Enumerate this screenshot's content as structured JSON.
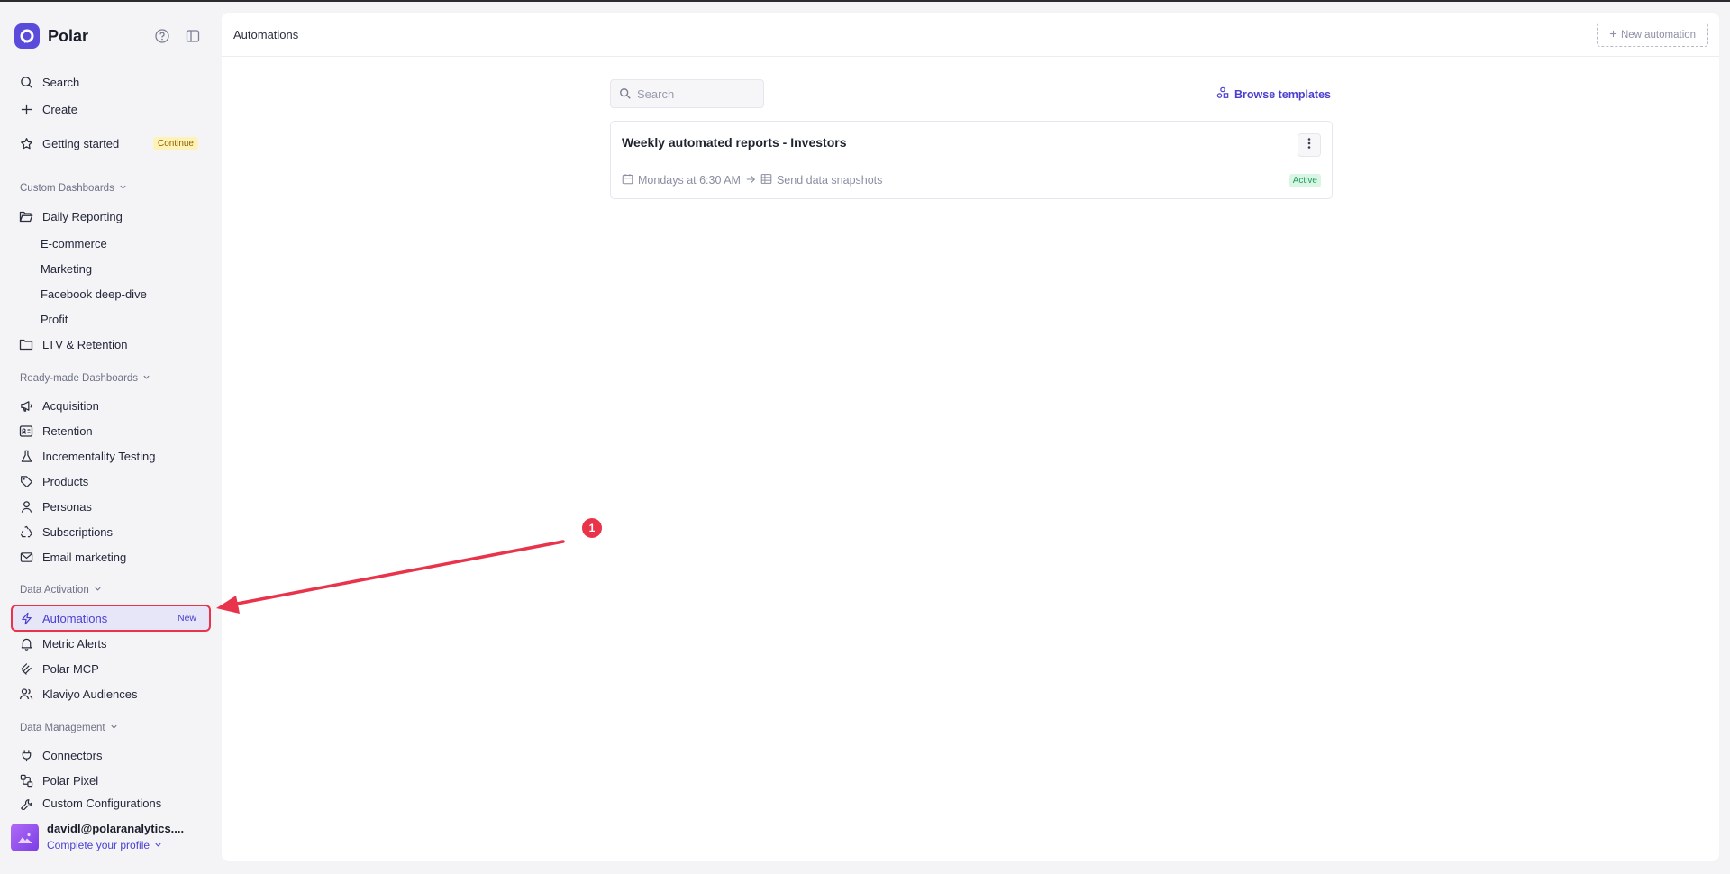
{
  "app": {
    "brand": "Polar",
    "colors": {
      "accent": "#4a3fd1",
      "brand": "#5b4bdb",
      "highlight": "#e8334a",
      "active_badge": "#1f9a5a"
    }
  },
  "sidebar": {
    "top_items": [
      {
        "label": "Search",
        "icon": "search-icon"
      },
      {
        "label": "Create",
        "icon": "plus-icon"
      },
      {
        "label": "Getting started",
        "icon": "star-icon",
        "badge": "Continue"
      }
    ],
    "custom_dashboards": {
      "label": "Custom Dashboards",
      "folder": "Daily Reporting",
      "children": [
        "E-commerce",
        "Marketing",
        "Facebook deep-dive",
        "Profit"
      ],
      "folder2": "LTV & Retention"
    },
    "ready_made": {
      "label": "Ready-made Dashboards",
      "items": [
        {
          "label": "Acquisition",
          "icon": "megaphone-icon"
        },
        {
          "label": "Retention",
          "icon": "id-card-icon"
        },
        {
          "label": "Incrementality Testing",
          "icon": "flask-icon"
        },
        {
          "label": "Products",
          "icon": "tag-icon"
        },
        {
          "label": "Personas",
          "icon": "user-icon"
        },
        {
          "label": "Subscriptions",
          "icon": "recycle-icon"
        },
        {
          "label": "Email marketing",
          "icon": "mail-icon"
        }
      ]
    },
    "data_activation": {
      "label": "Data Activation",
      "items": [
        {
          "label": "Automations",
          "icon": "lightning-icon",
          "badge": "New"
        },
        {
          "label": "Metric Alerts",
          "icon": "bell-icon"
        },
        {
          "label": "Polar MCP",
          "icon": "mcp-icon"
        },
        {
          "label": "Klaviyo Audiences",
          "icon": "users-icon"
        }
      ]
    },
    "data_management": {
      "label": "Data Management",
      "items": [
        {
          "label": "Connectors",
          "icon": "plug-icon"
        },
        {
          "label": "Polar Pixel",
          "icon": "pixel-icon"
        },
        {
          "label": "Custom Configurations",
          "icon": "wrench-icon"
        }
      ]
    },
    "profile": {
      "email": "davidl@polaranalytics....",
      "link": "Complete your profile"
    }
  },
  "main": {
    "title": "Automations",
    "new_button": "New automation",
    "search_placeholder": "Search",
    "browse_templates": "Browse templates",
    "automation": {
      "title": "Weekly automated reports - Investors",
      "schedule": "Mondays at 6:30 AM",
      "action": "Send data snapshots",
      "status": "Active"
    }
  },
  "annotation": {
    "step": "1"
  }
}
